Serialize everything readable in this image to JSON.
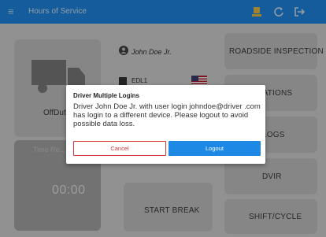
{
  "appbar": {
    "title": "Hours of Service",
    "menu_icon": "≡"
  },
  "status_card": {
    "status": "OffDuty",
    "timer_label": "Time Re...",
    "timer": "00:00"
  },
  "driver": {
    "name": "John Doe Jr.",
    "eld_label": "EDL1"
  },
  "side_buttons": {
    "roadside": "ROADSIDE INSPECTION",
    "violations": "VIOLATIONS",
    "logs": "LOGS",
    "dvir": "DVIR",
    "shift_cycle": "SHIFT/CYCLE"
  },
  "start_break": "START BREAK",
  "dialog": {
    "title": "Driver Multiple Logins",
    "message": "Driver John Doe Jr. with user login johndoe@driver .com has login to a different device. Please logout to avoid possible data loss.",
    "cancel_label": "Cancel",
    "logout_label": "Logout"
  },
  "colors": {
    "accent": "#1e88e5",
    "danger": "#d3353a"
  }
}
